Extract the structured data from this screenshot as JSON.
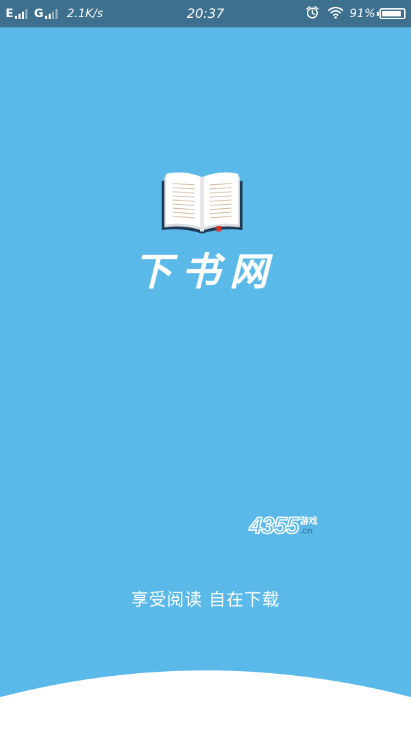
{
  "status_bar": {
    "network_1": "E",
    "network_2": "G",
    "speed": "2.1K/s",
    "time": "20:37",
    "battery_percent": "91%",
    "battery_level": 0.91,
    "icons": [
      "signal-icon",
      "alarm-icon",
      "wifi-icon",
      "battery-icon"
    ]
  },
  "app": {
    "title": "下书网",
    "slogan": "享受阅读 自在下载",
    "logo_icon": "open-book-icon"
  },
  "watermark": {
    "number": "4355",
    "chinese": "游戏",
    "domain": ".cn"
  },
  "colors": {
    "background": "#5ab9e8",
    "status_bar": "#3d6f8e",
    "arc": "#ffffff",
    "book_cover": "#1f3a56",
    "bookmark": "#d9342b"
  }
}
